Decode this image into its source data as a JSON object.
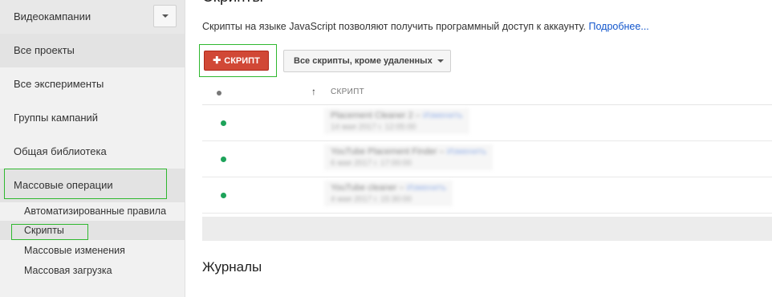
{
  "sidebar": {
    "top_label": "Видеокампании",
    "items": [
      {
        "label": "Все проекты"
      },
      {
        "label": "Все эксперименты"
      },
      {
        "label": "Группы кампаний"
      },
      {
        "label": "Общая библиотека"
      },
      {
        "label": "Массовые операции"
      }
    ],
    "sub_items": [
      {
        "label": "Автоматизированные правила"
      },
      {
        "label": "Скрипты"
      },
      {
        "label": "Массовые изменения"
      },
      {
        "label": "Массовая загрузка"
      }
    ]
  },
  "main": {
    "title": "Скрипты",
    "description": "Скрипты на языке JavaScript позволяют получить программный доступ к аккаунту.",
    "learn_more": "Подробнее...",
    "add_script_button": "СКРИПТ",
    "add_script_plus": "✚",
    "filter_button": "Все скрипты, кроме удаленных",
    "table": {
      "sort_arrow": "↑",
      "column_header": "СКРИПТ",
      "rows": [
        {
          "name": "Placement Cleaner 2",
          "action": "Изменить",
          "date": "14 мая 2017 г. 12:05:00"
        },
        {
          "name": "YouTube Placement Finder",
          "action": "Изменить",
          "date": "6 мая 2017 г. 17:00:00"
        },
        {
          "name": "YouTube cleaner",
          "action": "Изменить",
          "date": "4 мая 2017 г. 15:30:00"
        }
      ]
    },
    "logs_title": "Журналы"
  },
  "colors": {
    "accent_red": "#d14836",
    "highlight_green": "#2fb82f",
    "status_green": "#1ea35a",
    "link_blue": "#1155cc"
  }
}
